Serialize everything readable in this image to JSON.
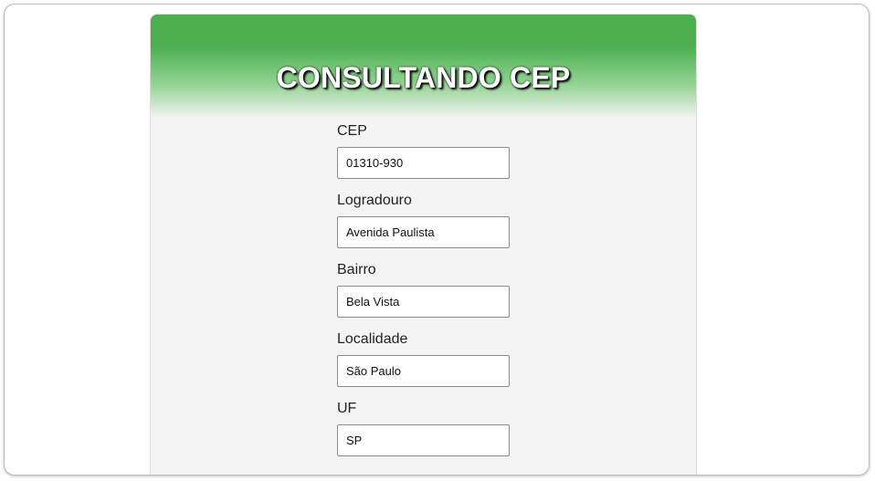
{
  "header": {
    "title": "CONSULTANDO CEP"
  },
  "form": {
    "fields": [
      {
        "label": "CEP",
        "value": "01310-930"
      },
      {
        "label": "Logradouro",
        "value": "Avenida Paulista"
      },
      {
        "label": "Bairro",
        "value": "Bela Vista"
      },
      {
        "label": "Localidade",
        "value": "São Paulo"
      },
      {
        "label": "UF",
        "value": "SP"
      }
    ]
  },
  "colors": {
    "header_green": "#4caf50",
    "card_background": "#f4f4f4"
  }
}
